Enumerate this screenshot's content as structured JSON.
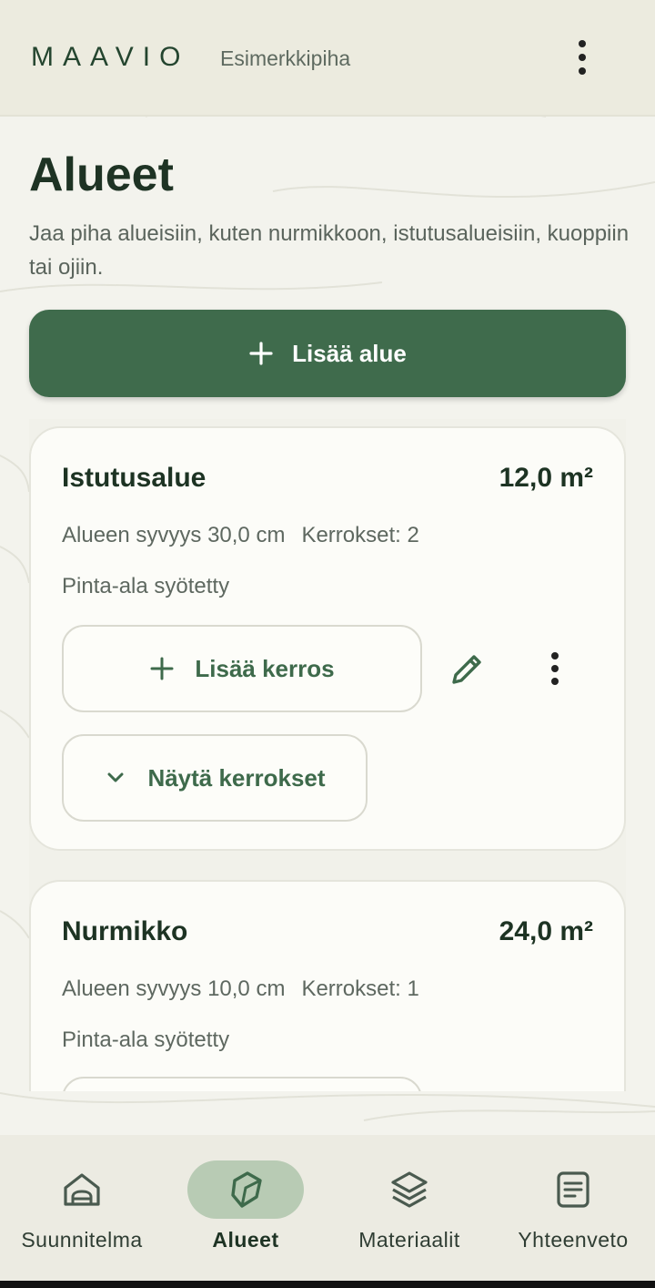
{
  "app": {
    "logo": "MAAVIO",
    "project_name": "Esimerkkipiha",
    "menu_icon": "more-vertical-icon"
  },
  "page": {
    "title": "Alueet",
    "description": "Jaa piha alueisiin, kuten nurmikkoon, istutusalueisiin, kuoppiin tai ojiin.",
    "add_area_label": "Lisää alue",
    "add_area_icon": "plus-icon"
  },
  "areas": [
    {
      "name": "Istutusalue",
      "area": "12,0 m²",
      "depth": "Alueen syvyys 30,0 cm",
      "layers": "Kerrokset: 2",
      "note": "Pinta-ala syötetty",
      "add_layer_label": "Lisää kerros",
      "show_layers_label": "Näytä kerrokset"
    },
    {
      "name": "Nurmikko",
      "area": "24,0 m²",
      "depth": "Alueen syvyys 10,0 cm",
      "layers": "Kerrokset: 1",
      "note": "Pinta-ala syötetty"
    }
  ],
  "nav": {
    "items": [
      {
        "label": "Suunnitelma",
        "icon": "home-icon",
        "active": false
      },
      {
        "label": "Alueet",
        "icon": "area-polygon-icon",
        "active": true
      },
      {
        "label": "Materiaalit",
        "icon": "layers-icon",
        "active": false
      },
      {
        "label": "Yhteenveto",
        "icon": "summary-document-icon",
        "active": false
      }
    ]
  },
  "colors": {
    "primary": "#3f6b4c",
    "header_bg": "#ecebdf",
    "card_bg": "#fcfcf8",
    "active_nav_pill": "#b8cbb4",
    "title_text": "#1e3324"
  }
}
